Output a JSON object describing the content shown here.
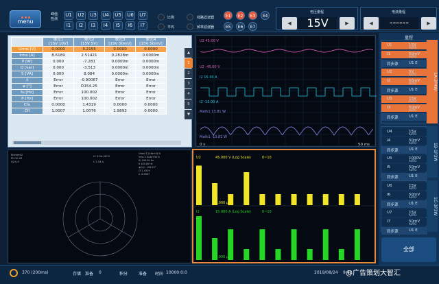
{
  "header": {
    "menu_label": "menu",
    "peak_label": "峰值检测",
    "u_channels": [
      "U1",
      "U2",
      "U3",
      "U4",
      "U5",
      "U6",
      "U7"
    ],
    "i_channels": [
      "I1",
      "I2",
      "I3",
      "I4",
      "I5",
      "I6",
      "I7"
    ],
    "ratio_label": "比例",
    "avg_label": "平均",
    "line_filter_label": "线路滤波器",
    "freq_filter_label": "频率滤波器",
    "e_chips": [
      "E1",
      "E2",
      "E3",
      "E4",
      "E5",
      "E6",
      "E7"
    ],
    "voltage_range_title": "电压量程",
    "voltage_range_value": "15V",
    "current_range_title": "电流量程",
    "current_range_value": "------"
  },
  "table": {
    "headers": [
      "单元1\n[15V 10V]",
      "单元2\n[15V 5V]",
      "单元3\n[15V 50mV]",
      "单元4\n[15V 50mV]"
    ],
    "rows": [
      {
        "label": "Urms [V]",
        "vals": [
          "0.0000",
          "3.2155",
          "0.0000",
          "0.0000"
        ],
        "sel": true
      },
      {
        "label": "Irms [A]",
        "vals": [
          "8.6189",
          "2.51421",
          "0.2828m",
          "0.0000m"
        ]
      },
      {
        "label": "P [W]",
        "vals": [
          "0.000",
          "-7.281",
          "0.0000m",
          "0.0000m"
        ]
      },
      {
        "label": "Q [var]",
        "vals": [
          "0.000",
          "-3.513",
          "0.0000m",
          "0.0000m"
        ]
      },
      {
        "label": "S [VA]",
        "vals": [
          "0.000",
          "8.084",
          "0.0000m",
          "0.0000m"
        ]
      },
      {
        "label": "λ",
        "vals": [
          "Error",
          "-0.90067",
          "Error",
          "Error"
        ]
      },
      {
        "label": "φ [°]",
        "vals": [
          "Error",
          "D154.25",
          "Error",
          "Error"
        ]
      },
      {
        "label": "fu [Hz]",
        "vals": [
          "Error",
          "100.002",
          "Error",
          "Error"
        ]
      },
      {
        "label": "fi [Hz]",
        "vals": [
          "Error",
          "100.002",
          "Error",
          "Error"
        ]
      },
      {
        "label": "Cfu",
        "vals": [
          "0.0000",
          "1.4319",
          "0.0000",
          "0.0000"
        ]
      },
      {
        "label": "CfI",
        "vals": [
          "1.0007",
          "1.0076",
          "1.9893",
          "0.0000"
        ]
      }
    ],
    "tabs": [
      "▲",
      "1",
      "2",
      "3",
      "4",
      "5",
      "▼"
    ]
  },
  "wave": {
    "labels": [
      "U2  45.00 V",
      "U2  -45.00 V",
      "I2  15.00 A",
      "I2  -15.00 A",
      "Math1  13.81 W",
      "Math1 -13.81 W"
    ],
    "time_start": "0 s",
    "time_end": "50 ms"
  },
  "vector": {
    "text_left": [
      "Element2",
      "PU:10.50",
      "U2:0.0"
    ],
    "text_mid": [
      "U: 3.3e+00 V",
      "I: 2.54 A"
    ],
    "text_right": [
      "Urms 3.216e+00 V",
      "Irms 2.514e+00 A",
      "fU 100.00 Hz",
      "fI 100.00 Hz",
      "φ(U,I) -154.25°",
      "Cf 1.4319",
      "λ -0.9007"
    ]
  },
  "harmonics": {
    "u_label": "U2",
    "u_scale": "45.000 V",
    "u_mode": "(Log Scale)",
    "u_range": "0~10",
    "u_bottom": "0.000 μV",
    "i_label": "I2",
    "i_scale": "15.000 A",
    "i_mode": "(Log Scale)",
    "i_range": "0~10",
    "i_bottom": "0.000 μA",
    "u_values": [
      0.9,
      0.5,
      0.25,
      0.75,
      0.25,
      0.25,
      0.25,
      0.25,
      0.25,
      0.25,
      0.25
    ],
    "i_values": [
      1.0,
      0.5,
      0.7,
      0.25,
      0.7,
      0.25,
      0.7,
      0.25,
      0.7,
      0.25,
      0.7
    ],
    "u_color": "#f2e526",
    "i_color": "#25d624"
  },
  "sidebar": {
    "title": "量程",
    "groups": [
      {
        "rows": [
          [
            "U1",
            "15V",
            "AUTO"
          ],
          [
            "I1",
            "50mV",
            "AUTO"
          ],
          [
            "同步源",
            "U1 E",
            ""
          ],
          [
            "U2",
            "5V",
            "AUTO"
          ],
          [
            "I2",
            "50mV",
            "AUTO"
          ],
          [
            "同步源",
            "U1 E",
            ""
          ],
          [
            "U3",
            "15V",
            "AUTO"
          ],
          [
            "I3",
            "50mV",
            "AUTO"
          ],
          [
            "同步源",
            "U1 E",
            ""
          ]
        ],
        "tab": "1A-3P4W",
        "active": true
      },
      {
        "rows": [
          [
            "U4",
            "15V",
            "AUTO"
          ],
          [
            "I4",
            "50mV",
            "AUTO"
          ],
          [
            "同步源",
            "U1 E",
            ""
          ],
          [
            "U5",
            "1000V",
            "AUTO"
          ],
          [
            "I5",
            "50mV",
            "AUTO"
          ],
          [
            "同步源",
            "U1 E",
            ""
          ]
        ],
        "tab": "1B-1P3W"
      },
      {
        "rows": [
          [
            "U6",
            "15V",
            "AUTO"
          ],
          [
            "I6",
            "50mV",
            "AUTO"
          ],
          [
            "同步源",
            "U1 E",
            ""
          ],
          [
            "U7",
            "15V",
            "AUTO"
          ],
          [
            "I7",
            "50mV",
            "AUTO"
          ],
          [
            "同步源",
            "U1 E",
            ""
          ]
        ],
        "tab": "1C-3P3W"
      }
    ],
    "all_label": "全部"
  },
  "status": {
    "rate": "370 (200ms)",
    "store_label": "存储",
    "store_val": "准备",
    "count": "0",
    "integ_label": "积分",
    "integ_val": "准备",
    "time_label": "时间",
    "time_val": "10000:0:0",
    "date": "2019/08/24",
    "clock": "9:40",
    "watermark": "@广告策划大智汇"
  }
}
